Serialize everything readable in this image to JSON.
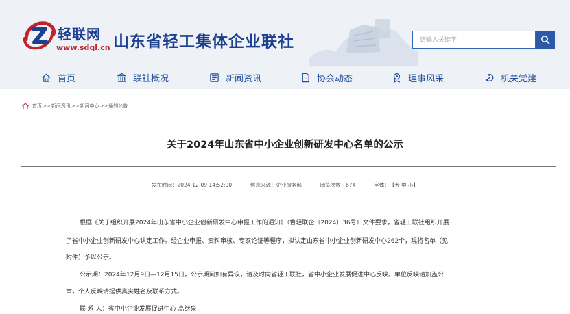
{
  "site": {
    "logo_text": "轻联网",
    "logo_url": "www.sdql.cn",
    "org_title": "山东省轻工集体企业联社"
  },
  "search": {
    "placeholder": "请输入关键字"
  },
  "nav": {
    "items": [
      {
        "label": "首页",
        "icon": "home-icon"
      },
      {
        "label": "联社概况",
        "icon": "institution-icon"
      },
      {
        "label": "新闻资讯",
        "icon": "newspaper-icon"
      },
      {
        "label": "协会动态",
        "icon": "document-icon"
      },
      {
        "label": "理事风采",
        "icon": "award-icon"
      },
      {
        "label": "机关党建",
        "icon": "party-emblem-icon"
      }
    ]
  },
  "breadcrumb": [
    "首页",
    "新闻资讯",
    "新闻中心",
    "通知公告"
  ],
  "breadcrumb_separator": ">>",
  "article": {
    "title": "关于2024年山东省中小企业创新研发中心名单的公示",
    "publish_label": "发布时间：",
    "publish_time": "2024-12-09 14:52:00",
    "source_label": "信息来源：",
    "source": "企业服务部",
    "views_label": "阅览次数：",
    "views": "874",
    "font_label": "字体：",
    "font_open": "【",
    "font_large": "大",
    "font_medium": "中",
    "font_small": "小",
    "font_close": "】",
    "paragraphs": [
      "根据《关于组织开展2024年山东省中小企业创新研发中心申报工作的通知》（鲁轻联企〔2024〕36号）文件要求，省轻工联社组织开展",
      "了省中小企业创新研发中心认定工作。经企业申报、资料审核、专家论证等程序，拟认定山东省中小企业创新研发中心262个，现将名单（见",
      "附件）予以公示。",
      "公示期：2024年12月9日—12月15日。公示期间如有异议，请及时向省轻工联社，省中小企业发展促进中心反映。单位反映请加盖公",
      "章，个人反映请提供真实姓名及联系方式。",
      "联 系 人：省中小企业发展促进中心 高继泉"
    ]
  },
  "colors": {
    "brand_blue": "#1c3f8f",
    "nav_text": "#1f4f99",
    "search_button": "#2d5aa8",
    "logo_red": "#c0232a",
    "header_bg": "#eef2f7"
  }
}
